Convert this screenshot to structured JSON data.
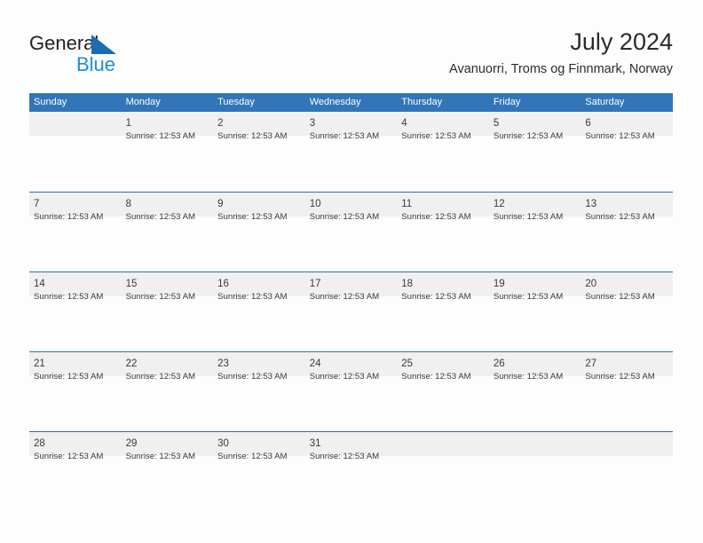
{
  "brand": {
    "name_part1": "General",
    "name_part2": "Blue",
    "triangle_color": "#1b6cb5",
    "text_color": "#231f20",
    "blue_color": "#1b8ae0"
  },
  "header": {
    "title": "July 2024",
    "subtitle": "Avanuorri, Troms og Finnmark, Norway"
  },
  "calendar": {
    "header_bg": "#3275b8",
    "band_bg": "#f0f0f0",
    "separator_color": "#2f6fad",
    "weekdays": [
      "Sunday",
      "Monday",
      "Tuesday",
      "Wednesday",
      "Thursday",
      "Friday",
      "Saturday"
    ],
    "weeks": [
      {
        "days": [
          {
            "number": "",
            "sunrise": ""
          },
          {
            "number": "1",
            "sunrise": "Sunrise: 12:53 AM"
          },
          {
            "number": "2",
            "sunrise": "Sunrise: 12:53 AM"
          },
          {
            "number": "3",
            "sunrise": "Sunrise: 12:53 AM"
          },
          {
            "number": "4",
            "sunrise": "Sunrise: 12:53 AM"
          },
          {
            "number": "5",
            "sunrise": "Sunrise: 12:53 AM"
          },
          {
            "number": "6",
            "sunrise": "Sunrise: 12:53 AM"
          }
        ]
      },
      {
        "days": [
          {
            "number": "7",
            "sunrise": "Sunrise: 12:53 AM"
          },
          {
            "number": "8",
            "sunrise": "Sunrise: 12:53 AM"
          },
          {
            "number": "9",
            "sunrise": "Sunrise: 12:53 AM"
          },
          {
            "number": "10",
            "sunrise": "Sunrise: 12:53 AM"
          },
          {
            "number": "11",
            "sunrise": "Sunrise: 12:53 AM"
          },
          {
            "number": "12",
            "sunrise": "Sunrise: 12:53 AM"
          },
          {
            "number": "13",
            "sunrise": "Sunrise: 12:53 AM"
          }
        ]
      },
      {
        "days": [
          {
            "number": "14",
            "sunrise": "Sunrise: 12:53 AM"
          },
          {
            "number": "15",
            "sunrise": "Sunrise: 12:53 AM"
          },
          {
            "number": "16",
            "sunrise": "Sunrise: 12:53 AM"
          },
          {
            "number": "17",
            "sunrise": "Sunrise: 12:53 AM"
          },
          {
            "number": "18",
            "sunrise": "Sunrise: 12:53 AM"
          },
          {
            "number": "19",
            "sunrise": "Sunrise: 12:53 AM"
          },
          {
            "number": "20",
            "sunrise": "Sunrise: 12:53 AM"
          }
        ]
      },
      {
        "days": [
          {
            "number": "21",
            "sunrise": "Sunrise: 12:53 AM"
          },
          {
            "number": "22",
            "sunrise": "Sunrise: 12:53 AM"
          },
          {
            "number": "23",
            "sunrise": "Sunrise: 12:53 AM"
          },
          {
            "number": "24",
            "sunrise": "Sunrise: 12:53 AM"
          },
          {
            "number": "25",
            "sunrise": "Sunrise: 12:53 AM"
          },
          {
            "number": "26",
            "sunrise": "Sunrise: 12:53 AM"
          },
          {
            "number": "27",
            "sunrise": "Sunrise: 12:53 AM"
          }
        ]
      },
      {
        "days": [
          {
            "number": "28",
            "sunrise": "Sunrise: 12:53 AM"
          },
          {
            "number": "29",
            "sunrise": "Sunrise: 12:53 AM"
          },
          {
            "number": "30",
            "sunrise": "Sunrise: 12:53 AM"
          },
          {
            "number": "31",
            "sunrise": "Sunrise: 12:53 AM"
          },
          {
            "number": "",
            "sunrise": ""
          },
          {
            "number": "",
            "sunrise": ""
          },
          {
            "number": "",
            "sunrise": ""
          }
        ]
      }
    ]
  }
}
